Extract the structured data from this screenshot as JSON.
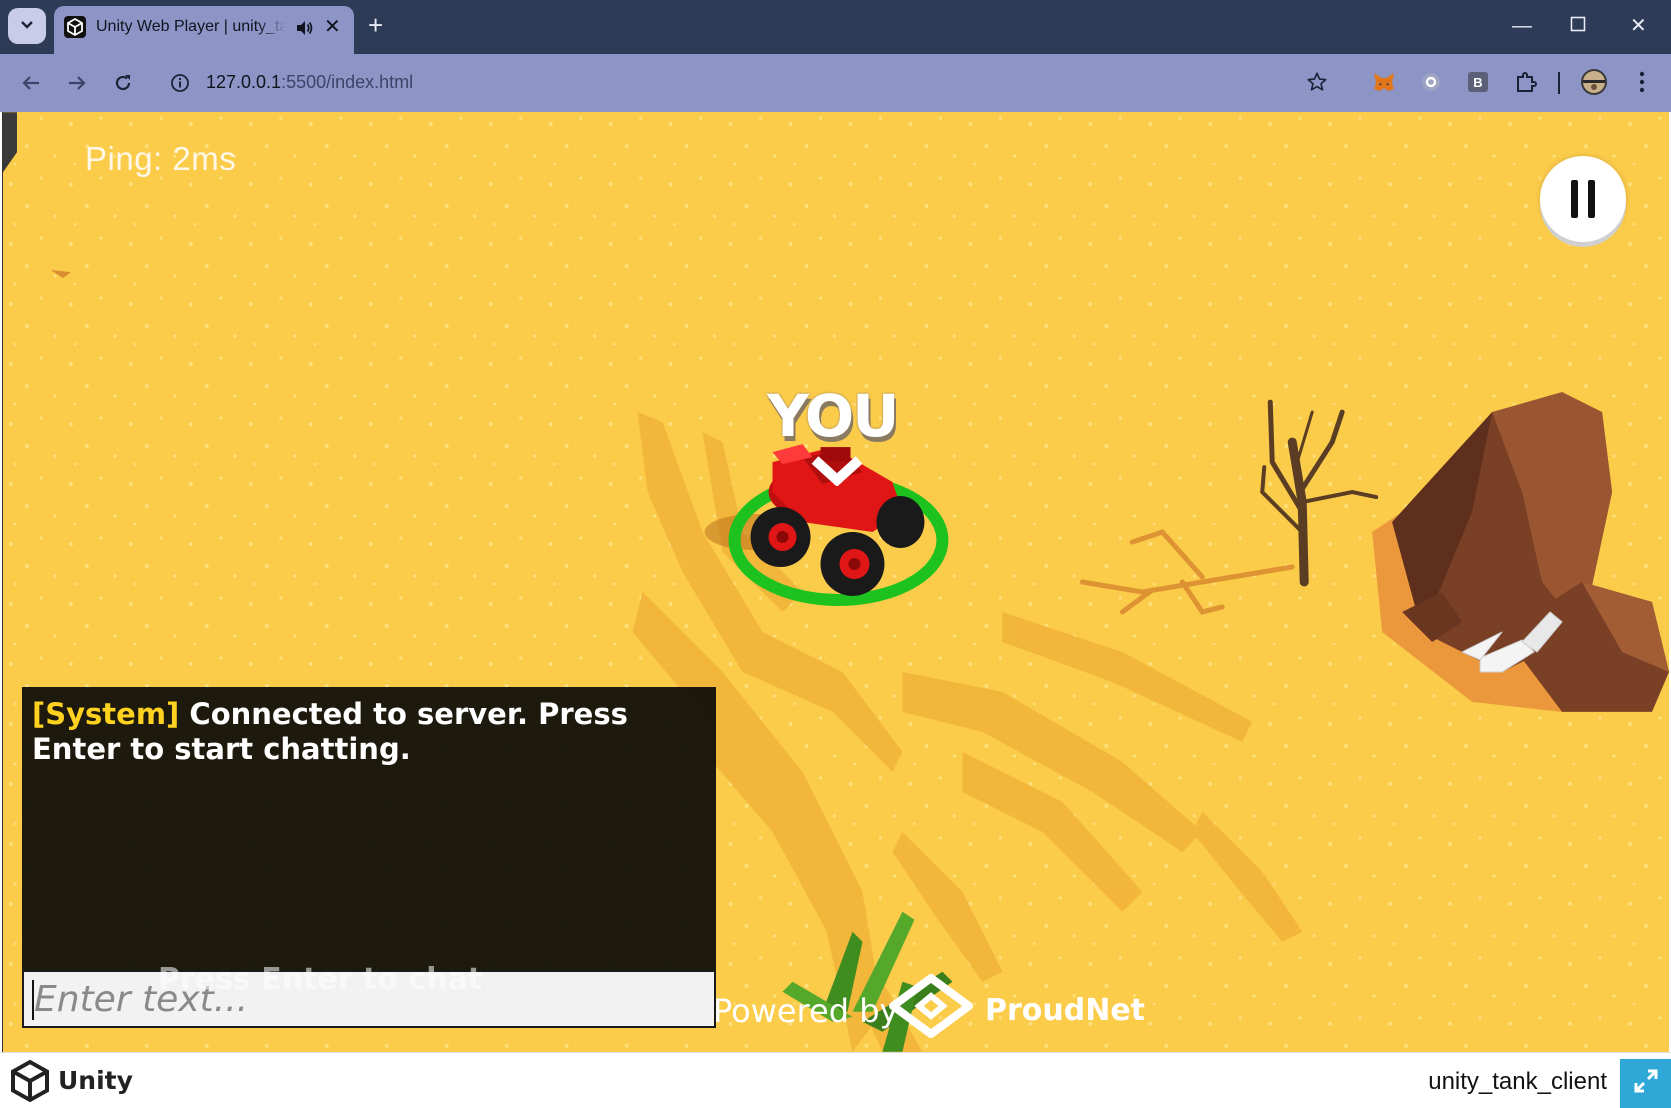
{
  "browser": {
    "tab_title": "Unity Web Player | unity_tank_client",
    "url_host": "127.0.0.1",
    "url_rest": ":5500/index.html",
    "window_controls": [
      "minimize-icon",
      "maximize-icon",
      "close-icon"
    ]
  },
  "game": {
    "ping": "Ping: 2ms",
    "player_label": "YOU",
    "chat": {
      "system_tag": "[System]",
      "system_message": " Connected to server. Press Enter to start chatting.",
      "hint": "Press Enter to chat",
      "input_placeholder": "Enter text..."
    },
    "powered_by": "Powered by",
    "brand": "ProudNet"
  },
  "footer": {
    "engine": "Unity",
    "build_title": "unity_tank_client",
    "accent": "#2fa8d8"
  },
  "colors": {
    "sand": "#fbcb4a",
    "tab_bar": "#2d3b57",
    "toolbar": "#8d95c7",
    "tank": "#e01515",
    "ring": "#1ec21e"
  }
}
